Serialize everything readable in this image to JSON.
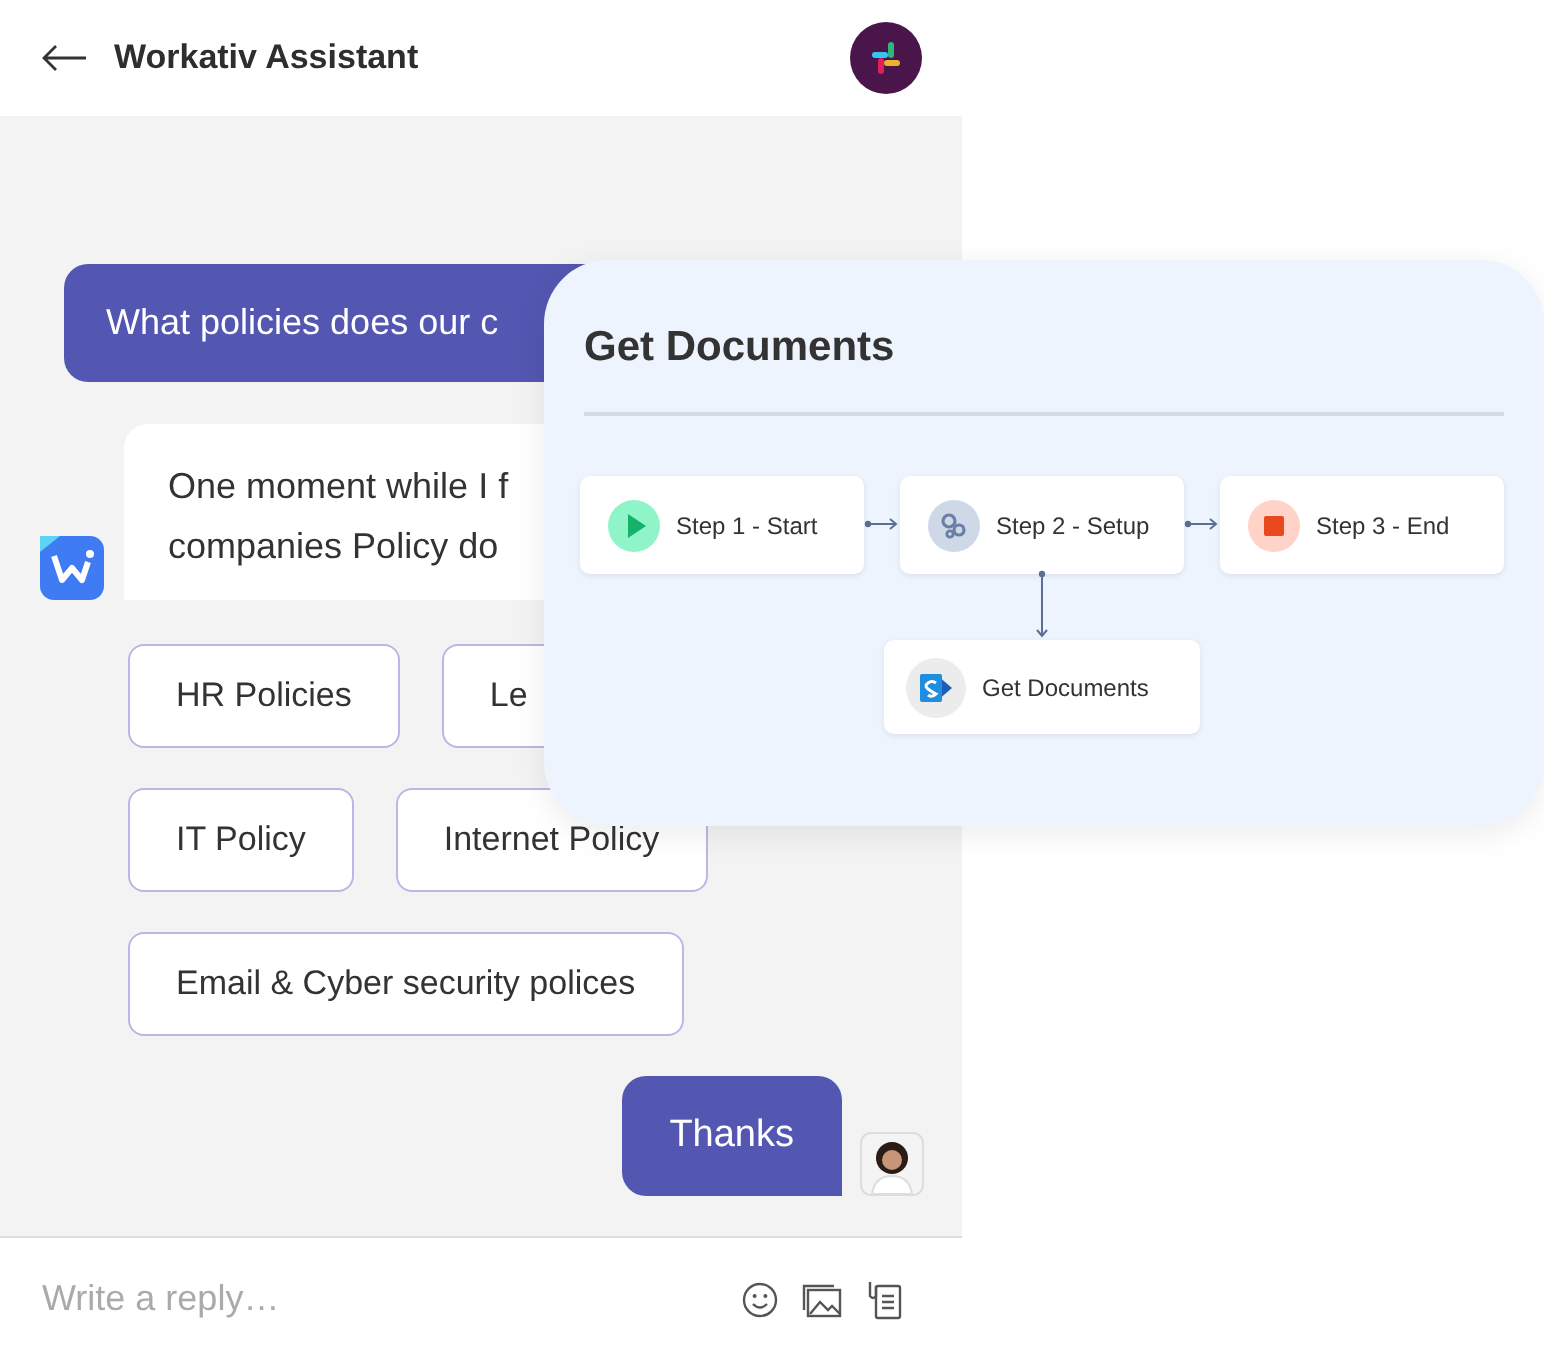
{
  "header": {
    "title": "Workativ Assistant"
  },
  "user_message": {
    "text": "What policies does our c"
  },
  "bot_message": {
    "lines": [
      "One moment while I f",
      "companies Policy do"
    ]
  },
  "option_rows": [
    [
      {
        "label": "HR Policies"
      },
      {
        "label": "Le"
      }
    ],
    [
      {
        "label": "IT Policy"
      },
      {
        "label": "Internet Policy"
      }
    ],
    [
      {
        "label": "Email & Cyber security polices"
      }
    ]
  ],
  "reply": {
    "text": "Thanks"
  },
  "composer": {
    "placeholder": "Write a reply…"
  },
  "workflow": {
    "title": "Get Documents",
    "steps": [
      {
        "kind": "start",
        "label": "Step 1 - Start"
      },
      {
        "kind": "setup",
        "label": "Step 2 - Setup"
      },
      {
        "kind": "end",
        "label": "Step 3 - End"
      }
    ],
    "action": {
      "label": "Get Documents"
    }
  }
}
